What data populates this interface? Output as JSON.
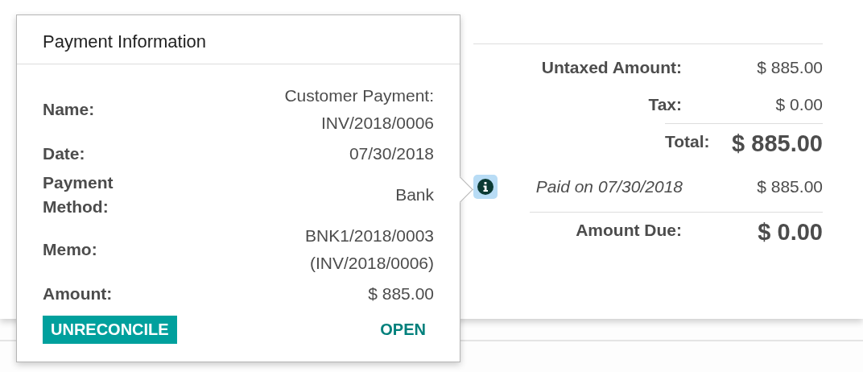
{
  "totals": {
    "rows": [
      {
        "kind": "line",
        "label": "Untaxed Amount:",
        "value": "$ 885.00"
      },
      {
        "kind": "line",
        "label": "Tax:",
        "value": "$ 0.00"
      },
      {
        "kind": "total",
        "label": "Total:",
        "value": "$ 885.00"
      },
      {
        "kind": "payment",
        "label": "Paid on 07/30/2018",
        "value": "$ 885.00"
      },
      {
        "kind": "due",
        "label": "Amount Due:",
        "value": "$ 0.00"
      }
    ]
  },
  "popover": {
    "title": "Payment Information",
    "fields": [
      {
        "label": "Name:",
        "value": "Customer Payment: INV/2018/0006"
      },
      {
        "label": "Date:",
        "value": "07/30/2018"
      },
      {
        "label": "Payment Method:",
        "value": "Bank"
      },
      {
        "label": "Memo:",
        "value": "BNK1/2018/0003 (INV/2018/0006)"
      },
      {
        "label": "Amount:",
        "value": "$ 885.00"
      }
    ],
    "buttons": [
      {
        "label": "UNRECONCILE",
        "kind": "primary"
      },
      {
        "label": "OPEN",
        "kind": "link"
      }
    ]
  }
}
